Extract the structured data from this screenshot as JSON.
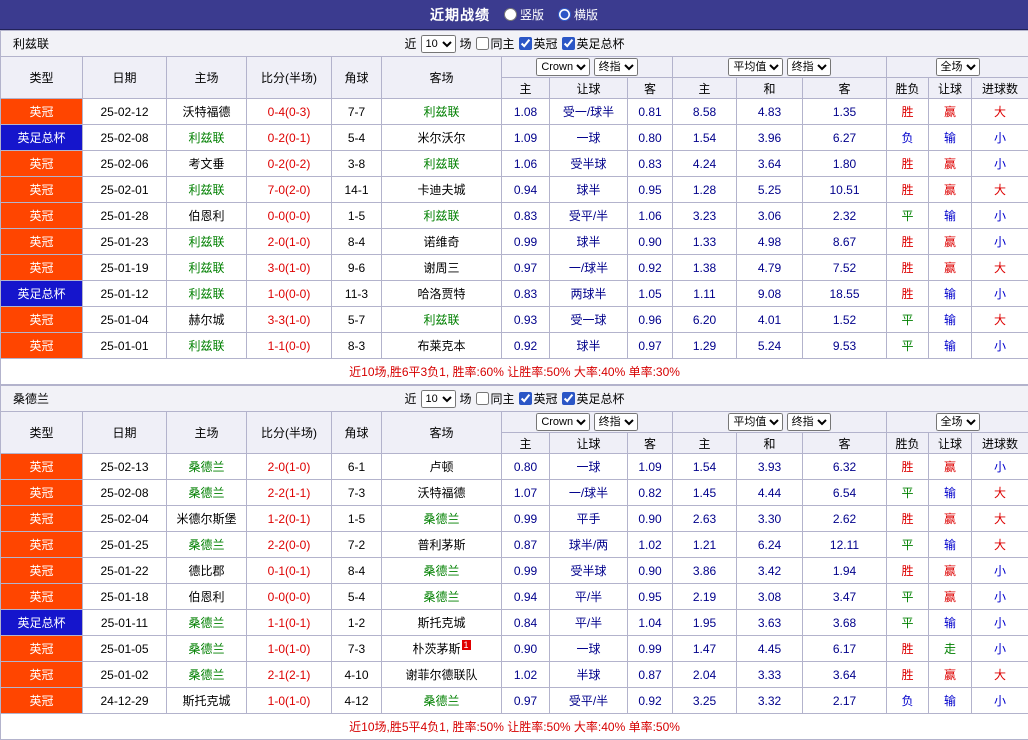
{
  "topbar": {
    "title": "近期战绩",
    "layout_options": [
      {
        "label": "竖版",
        "checked": false
      },
      {
        "label": "横版",
        "checked": true
      }
    ]
  },
  "labels": {
    "type": "类型",
    "date": "日期",
    "home": "主场",
    "score": "比分(半场)",
    "corners": "角球",
    "away": "客场",
    "h": "主",
    "handicap": "让球",
    "a": "客",
    "avg_h": "主",
    "avg_d": "和",
    "avg_a": "客",
    "result": "胜负",
    "handicap_result": "让球",
    "goals": "进球数",
    "near": "近",
    "matches": "场"
  },
  "dropdowns": {
    "count": "10",
    "bookmaker": "Crown",
    "final": "终指",
    "average": "平均值",
    "fulltime": "全场"
  },
  "colors": {
    "win": "#dd0000",
    "draw": "#008000",
    "loss": "#0000cc",
    "league_badge": "#ff4500",
    "cup_badge": "#1515cc",
    "team_green": "#008000",
    "score_red": "#dd0000",
    "odds_blue": "#00008b",
    "topbar_bg": "#3b3b8f"
  },
  "sections": [
    {
      "team": "利兹联",
      "filters": [
        {
          "label": "同主",
          "checked": false
        },
        {
          "label": "英冠",
          "checked": true
        },
        {
          "label": "英足总杯",
          "checked": true
        }
      ],
      "rows": [
        {
          "comp": "英冠",
          "comp_cls": "league",
          "date": "25-02-12",
          "home": "沃特福德",
          "home_cls": "",
          "score": "0-4(0-3)",
          "corners": "7-7",
          "away": "利兹联",
          "away_cls": "green",
          "away_rc": "",
          "o1": "1.08",
          "hcap": "受一/球半",
          "o2": "0.81",
          "m1": "8.58",
          "m2": "4.83",
          "m3": "1.35",
          "res": "胜",
          "res_cls": "red",
          "hr": "赢",
          "hr_cls": "red",
          "ou": "大",
          "ou_cls": "red"
        },
        {
          "comp": "英足总杯",
          "comp_cls": "cup",
          "date": "25-02-08",
          "home": "利兹联",
          "home_cls": "green",
          "score": "0-2(0-1)",
          "corners": "5-4",
          "away": "米尔沃尔",
          "away_cls": "",
          "away_rc": "",
          "o1": "1.09",
          "hcap": "一球",
          "o2": "0.80",
          "m1": "1.54",
          "m2": "3.96",
          "m3": "6.27",
          "res": "负",
          "res_cls": "blue",
          "hr": "输",
          "hr_cls": "blue",
          "ou": "小",
          "ou_cls": "blue"
        },
        {
          "comp": "英冠",
          "comp_cls": "league",
          "date": "25-02-06",
          "home": "考文垂",
          "home_cls": "",
          "score": "0-2(0-2)",
          "corners": "3-8",
          "away": "利兹联",
          "away_cls": "green",
          "away_rc": "",
          "o1": "1.06",
          "hcap": "受半球",
          "o2": "0.83",
          "m1": "4.24",
          "m2": "3.64",
          "m3": "1.80",
          "res": "胜",
          "res_cls": "red",
          "hr": "赢",
          "hr_cls": "red",
          "ou": "小",
          "ou_cls": "blue"
        },
        {
          "comp": "英冠",
          "comp_cls": "league",
          "date": "25-02-01",
          "home": "利兹联",
          "home_cls": "green",
          "score": "7-0(2-0)",
          "corners": "14-1",
          "away": "卡迪夫城",
          "away_cls": "",
          "away_rc": "",
          "o1": "0.94",
          "hcap": "球半",
          "o2": "0.95",
          "m1": "1.28",
          "m2": "5.25",
          "m3": "10.51",
          "res": "胜",
          "res_cls": "red",
          "hr": "赢",
          "hr_cls": "red",
          "ou": "大",
          "ou_cls": "red"
        },
        {
          "comp": "英冠",
          "comp_cls": "league",
          "date": "25-01-28",
          "home": "伯恩利",
          "home_cls": "",
          "score": "0-0(0-0)",
          "corners": "1-5",
          "away": "利兹联",
          "away_cls": "green",
          "away_rc": "",
          "o1": "0.83",
          "hcap": "受平/半",
          "o2": "1.06",
          "m1": "3.23",
          "m2": "3.06",
          "m3": "2.32",
          "res": "平",
          "res_cls": "green",
          "hr": "输",
          "hr_cls": "blue",
          "ou": "小",
          "ou_cls": "blue"
        },
        {
          "comp": "英冠",
          "comp_cls": "league",
          "date": "25-01-23",
          "home": "利兹联",
          "home_cls": "green",
          "score": "2-0(1-0)",
          "corners": "8-4",
          "away": "诺维奇",
          "away_cls": "",
          "away_rc": "",
          "o1": "0.99",
          "hcap": "球半",
          "o2": "0.90",
          "m1": "1.33",
          "m2": "4.98",
          "m3": "8.67",
          "res": "胜",
          "res_cls": "red",
          "hr": "赢",
          "hr_cls": "red",
          "ou": "小",
          "ou_cls": "blue"
        },
        {
          "comp": "英冠",
          "comp_cls": "league",
          "date": "25-01-19",
          "home": "利兹联",
          "home_cls": "green",
          "score": "3-0(1-0)",
          "corners": "9-6",
          "away": "谢周三",
          "away_cls": "",
          "away_rc": "",
          "o1": "0.97",
          "hcap": "一/球半",
          "o2": "0.92",
          "m1": "1.38",
          "m2": "4.79",
          "m3": "7.52",
          "res": "胜",
          "res_cls": "red",
          "hr": "赢",
          "hr_cls": "red",
          "ou": "大",
          "ou_cls": "red"
        },
        {
          "comp": "英足总杯",
          "comp_cls": "cup",
          "date": "25-01-12",
          "home": "利兹联",
          "home_cls": "green",
          "score": "1-0(0-0)",
          "corners": "11-3",
          "away": "哈洛贾特",
          "away_cls": "",
          "away_rc": "",
          "o1": "0.83",
          "hcap": "两球半",
          "o2": "1.05",
          "m1": "1.11",
          "m2": "9.08",
          "m3": "18.55",
          "res": "胜",
          "res_cls": "red",
          "hr": "输",
          "hr_cls": "blue",
          "ou": "小",
          "ou_cls": "blue"
        },
        {
          "comp": "英冠",
          "comp_cls": "league",
          "date": "25-01-04",
          "home": "赫尔城",
          "home_cls": "",
          "score": "3-3(1-0)",
          "corners": "5-7",
          "away": "利兹联",
          "away_cls": "green",
          "away_rc": "",
          "o1": "0.93",
          "hcap": "受一球",
          "o2": "0.96",
          "m1": "6.20",
          "m2": "4.01",
          "m3": "1.52",
          "res": "平",
          "res_cls": "green",
          "hr": "输",
          "hr_cls": "blue",
          "ou": "大",
          "ou_cls": "red"
        },
        {
          "comp": "英冠",
          "comp_cls": "league",
          "date": "25-01-01",
          "home": "利兹联",
          "home_cls": "green",
          "score": "1-1(0-0)",
          "corners": "8-3",
          "away": "布莱克本",
          "away_cls": "",
          "away_rc": "",
          "o1": "0.92",
          "hcap": "球半",
          "o2": "0.97",
          "m1": "1.29",
          "m2": "5.24",
          "m3": "9.53",
          "res": "平",
          "res_cls": "green",
          "hr": "输",
          "hr_cls": "blue",
          "ou": "小",
          "ou_cls": "blue"
        }
      ],
      "summary": "近10场,胜6平3负1, 胜率:60% 让胜率:50% 大率:40% 单率:30%"
    },
    {
      "team": "桑德兰",
      "filters": [
        {
          "label": "同主",
          "checked": false
        },
        {
          "label": "英冠",
          "checked": true
        },
        {
          "label": "英足总杯",
          "checked": true
        }
      ],
      "rows": [
        {
          "comp": "英冠",
          "comp_cls": "league",
          "date": "25-02-13",
          "home": "桑德兰",
          "home_cls": "green",
          "score": "2-0(1-0)",
          "corners": "6-1",
          "away": "卢顿",
          "away_cls": "",
          "away_rc": "",
          "o1": "0.80",
          "hcap": "一球",
          "o2": "1.09",
          "m1": "1.54",
          "m2": "3.93",
          "m3": "6.32",
          "res": "胜",
          "res_cls": "red",
          "hr": "赢",
          "hr_cls": "red",
          "ou": "小",
          "ou_cls": "blue"
        },
        {
          "comp": "英冠",
          "comp_cls": "league",
          "date": "25-02-08",
          "home": "桑德兰",
          "home_cls": "green",
          "score": "2-2(1-1)",
          "corners": "7-3",
          "away": "沃特福德",
          "away_cls": "",
          "away_rc": "",
          "o1": "1.07",
          "hcap": "一/球半",
          "o2": "0.82",
          "m1": "1.45",
          "m2": "4.44",
          "m3": "6.54",
          "res": "平",
          "res_cls": "green",
          "hr": "输",
          "hr_cls": "blue",
          "ou": "大",
          "ou_cls": "red"
        },
        {
          "comp": "英冠",
          "comp_cls": "league",
          "date": "25-02-04",
          "home": "米德尔斯堡",
          "home_cls": "",
          "score": "1-2(0-1)",
          "corners": "1-5",
          "away": "桑德兰",
          "away_cls": "green",
          "away_rc": "",
          "o1": "0.99",
          "hcap": "平手",
          "o2": "0.90",
          "m1": "2.63",
          "m2": "3.30",
          "m3": "2.62",
          "res": "胜",
          "res_cls": "red",
          "hr": "赢",
          "hr_cls": "red",
          "ou": "大",
          "ou_cls": "red"
        },
        {
          "comp": "英冠",
          "comp_cls": "league",
          "date": "25-01-25",
          "home": "桑德兰",
          "home_cls": "green",
          "score": "2-2(0-0)",
          "corners": "7-2",
          "away": "普利茅斯",
          "away_cls": "",
          "away_rc": "",
          "o1": "0.87",
          "hcap": "球半/两",
          "o2": "1.02",
          "m1": "1.21",
          "m2": "6.24",
          "m3": "12.11",
          "res": "平",
          "res_cls": "green",
          "hr": "输",
          "hr_cls": "blue",
          "ou": "大",
          "ou_cls": "red"
        },
        {
          "comp": "英冠",
          "comp_cls": "league",
          "date": "25-01-22",
          "home": "德比郡",
          "home_cls": "",
          "score": "0-1(0-1)",
          "corners": "8-4",
          "away": "桑德兰",
          "away_cls": "green",
          "away_rc": "",
          "o1": "0.99",
          "hcap": "受半球",
          "o2": "0.90",
          "m1": "3.86",
          "m2": "3.42",
          "m3": "1.94",
          "res": "胜",
          "res_cls": "red",
          "hr": "赢",
          "hr_cls": "red",
          "ou": "小",
          "ou_cls": "blue"
        },
        {
          "comp": "英冠",
          "comp_cls": "league",
          "date": "25-01-18",
          "home": "伯恩利",
          "home_cls": "",
          "score": "0-0(0-0)",
          "corners": "5-4",
          "away": "桑德兰",
          "away_cls": "green",
          "away_rc": "",
          "o1": "0.94",
          "hcap": "平/半",
          "o2": "0.95",
          "m1": "2.19",
          "m2": "3.08",
          "m3": "3.47",
          "res": "平",
          "res_cls": "green",
          "hr": "赢",
          "hr_cls": "red",
          "ou": "小",
          "ou_cls": "blue"
        },
        {
          "comp": "英足总杯",
          "comp_cls": "cup",
          "date": "25-01-11",
          "home": "桑德兰",
          "home_cls": "green",
          "score": "1-1(0-1)",
          "corners": "1-2",
          "away": "斯托克城",
          "away_cls": "",
          "away_rc": "",
          "o1": "0.84",
          "hcap": "平/半",
          "o2": "1.04",
          "m1": "1.95",
          "m2": "3.63",
          "m3": "3.68",
          "res": "平",
          "res_cls": "green",
          "hr": "输",
          "hr_cls": "blue",
          "ou": "小",
          "ou_cls": "blue"
        },
        {
          "comp": "英冠",
          "comp_cls": "league",
          "date": "25-01-05",
          "home": "桑德兰",
          "home_cls": "green",
          "score": "1-0(1-0)",
          "corners": "7-3",
          "away": "朴茨茅斯",
          "away_cls": "",
          "away_rc": "1",
          "o1": "0.90",
          "hcap": "一球",
          "o2": "0.99",
          "m1": "1.47",
          "m2": "4.45",
          "m3": "6.17",
          "res": "胜",
          "res_cls": "red",
          "hr": "走",
          "hr_cls": "green",
          "ou": "小",
          "ou_cls": "blue"
        },
        {
          "comp": "英冠",
          "comp_cls": "league",
          "date": "25-01-02",
          "home": "桑德兰",
          "home_cls": "green",
          "score": "2-1(2-1)",
          "corners": "4-10",
          "away": "谢菲尔德联队",
          "away_cls": "",
          "away_rc": "",
          "o1": "1.02",
          "hcap": "半球",
          "o2": "0.87",
          "m1": "2.04",
          "m2": "3.33",
          "m3": "3.64",
          "res": "胜",
          "res_cls": "red",
          "hr": "赢",
          "hr_cls": "red",
          "ou": "大",
          "ou_cls": "red"
        },
        {
          "comp": "英冠",
          "comp_cls": "league",
          "date": "24-12-29",
          "home": "斯托克城",
          "home_cls": "",
          "score": "1-0(1-0)",
          "corners": "4-12",
          "away": "桑德兰",
          "away_cls": "green",
          "away_rc": "",
          "o1": "0.97",
          "hcap": "受平/半",
          "o2": "0.92",
          "m1": "3.25",
          "m2": "3.32",
          "m3": "2.17",
          "res": "负",
          "res_cls": "blue",
          "hr": "输",
          "hr_cls": "blue",
          "ou": "小",
          "ou_cls": "blue"
        }
      ],
      "summary": "近10场,胜5平4负1, 胜率:50% 让胜率:50% 大率:40% 单率:50%"
    }
  ]
}
